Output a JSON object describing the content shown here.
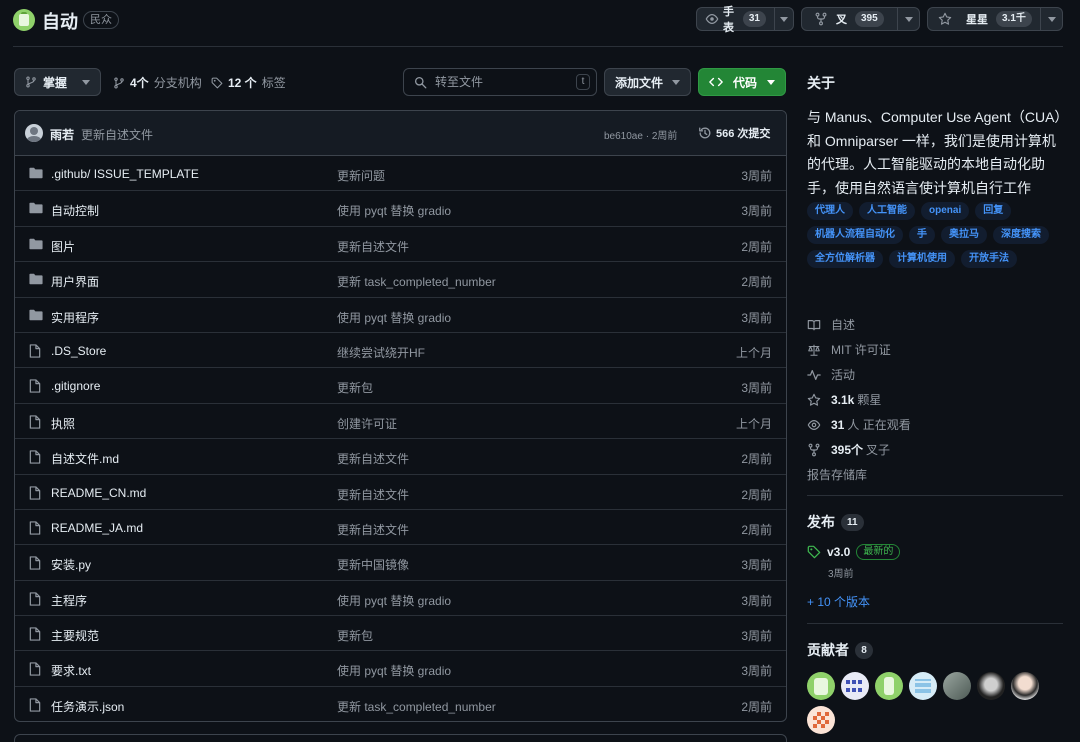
{
  "repo": {
    "name": "自动",
    "visibility": "民众"
  },
  "header_actions": {
    "watch": {
      "label": "手表",
      "count": "31"
    },
    "fork": {
      "label": "叉",
      "count": "395"
    },
    "star": {
      "label": "星星",
      "count": "3.1千"
    }
  },
  "toolbar": {
    "branch": "掌握",
    "branches_count": "4个",
    "branches_label": "分支机构",
    "tags_count": "12 个",
    "tags_label": "标签",
    "search_placeholder": "转至文件",
    "search_shortcut": "t",
    "add_file": "添加文件",
    "code": "代码"
  },
  "latest_commit": {
    "author": "雨若",
    "message": "更新自述文件",
    "hash_time": "be610ae · 2周前",
    "history": "566 次提交"
  },
  "files": [
    {
      "type": "dir",
      "name": ".github/ ISSUE_TEMPLATE",
      "commit": "更新问题",
      "time": "3周前"
    },
    {
      "type": "dir",
      "name": "自动控制",
      "commit": "使用 pyqt 替换 gradio",
      "time": "3周前"
    },
    {
      "type": "dir",
      "name": "图片",
      "commit": "更新自述文件",
      "time": "2周前"
    },
    {
      "type": "dir",
      "name": "用户界面",
      "commit": "更新 task_completed_number",
      "time": "2周前"
    },
    {
      "type": "dir",
      "name": "实用程序",
      "commit": "使用 pyqt 替换 gradio",
      "time": "3周前"
    },
    {
      "type": "file",
      "name": ".DS_Store",
      "commit": "继续尝试绕开HF",
      "time": "上个月"
    },
    {
      "type": "file",
      "name": ".gitignore",
      "commit": "更新包",
      "time": "3周前"
    },
    {
      "type": "file",
      "name": "执照",
      "commit": "创建许可证",
      "time": "上个月"
    },
    {
      "type": "file",
      "name": "自述文件.md",
      "commit": "更新自述文件",
      "time": "2周前"
    },
    {
      "type": "file",
      "name": "README_CN.md",
      "commit": "更新自述文件",
      "time": "2周前"
    },
    {
      "type": "file",
      "name": "README_JA.md",
      "commit": "更新自述文件",
      "time": "2周前"
    },
    {
      "type": "file",
      "name": "安装.py",
      "commit": "更新中国镜像",
      "time": "3周前"
    },
    {
      "type": "file",
      "name": "主程序",
      "commit": "使用 pyqt 替换 gradio",
      "time": "3周前"
    },
    {
      "type": "file",
      "name": "主要规范",
      "commit": "更新包",
      "time": "3周前"
    },
    {
      "type": "file",
      "name": "要求.txt",
      "commit": "使用 pyqt 替换 gradio",
      "time": "3周前"
    },
    {
      "type": "file",
      "name": "任务演示.json",
      "commit": "更新 task_completed_number",
      "time": "2周前"
    }
  ],
  "about": {
    "heading": "关于",
    "description": "与 Manus、Computer Use Agent（CUA）和 Omniparser 一样，我们是使用计算机的代理。人工智能驱动的本地自动化助手，使用自然语言使计算机自行工作",
    "topics": [
      "代理人",
      "人工智能",
      "openai",
      "回复",
      "机器人流程自动化",
      "手",
      "奥拉马",
      "深度搜索",
      "全方位解析器",
      "计算机使用",
      "开放手法"
    ],
    "readme": "自述",
    "license": "MIT 许可证",
    "activity": "活动",
    "stars_count": "3.1k",
    "stars_label": "颗星",
    "watching_count": "31",
    "watching_label": "人 正在观看",
    "forks_count": "395个",
    "forks_label": "叉子",
    "report": "报告存储库"
  },
  "releases": {
    "heading": "发布",
    "count": "11",
    "version": "v3.0",
    "latest_label": "最新的",
    "date": "3周前",
    "more": "+ 10 个版本"
  },
  "contributors": {
    "heading": "贡献者",
    "count": "8",
    "avatars": [
      "robot-green",
      "pixel-blue",
      "robot-green-2",
      "pixel-lightblue",
      "photo-landscape",
      "photo-dark",
      "photo-portrait",
      "pixel-orange"
    ]
  },
  "colors": {
    "background": "#0d1117",
    "accent_green": "#238636",
    "link_blue": "#4493f8",
    "muted_text": "#9198a1"
  }
}
